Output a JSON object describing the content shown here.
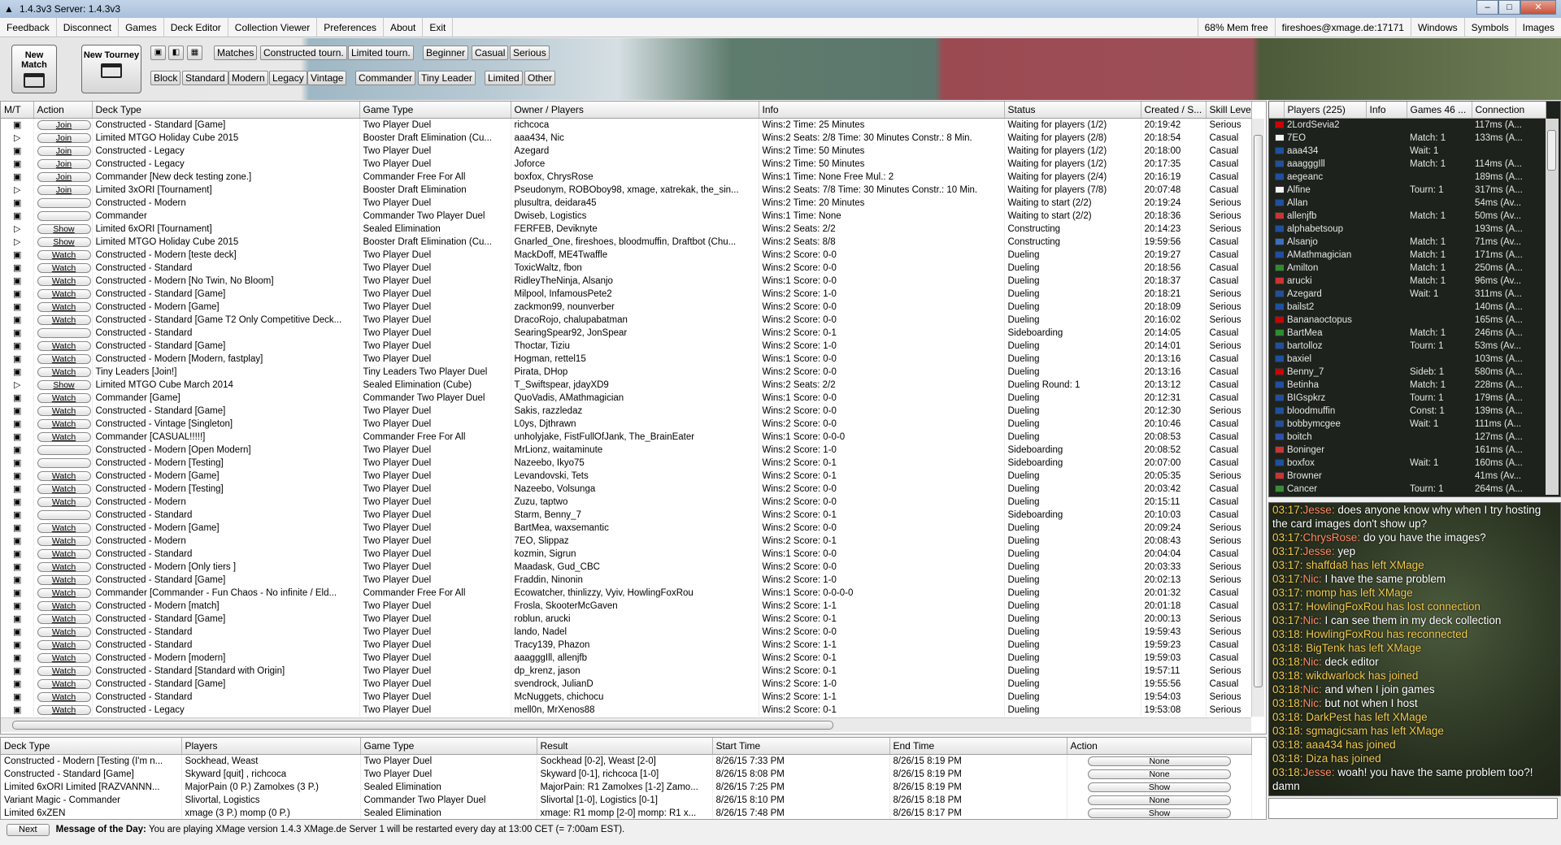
{
  "window": {
    "title": "1.4.3v3  Server: 1.4.3v3"
  },
  "menu": {
    "left": [
      "Feedback",
      "Disconnect",
      "Games",
      "Deck Editor",
      "Collection Viewer",
      "Preferences",
      "About",
      "Exit"
    ],
    "right": [
      "68% Mem free",
      "fireshoes@xmage.de:17171",
      "Windows",
      "Symbols",
      "Images"
    ]
  },
  "toolbar": {
    "new_match": "New Match",
    "new_tourney": "New Tourney",
    "row1": [
      "Matches",
      "Constructed tourn.",
      "Limited tourn.",
      "Beginner",
      "Casual",
      "Serious"
    ],
    "row2": [
      "Block",
      "Standard",
      "Modern",
      "Legacy",
      "Vintage",
      "Commander",
      "Tiny Leader",
      "Limited",
      "Other"
    ]
  },
  "games": {
    "columns": [
      "M/T",
      "Action",
      "Deck Type",
      "Game Type",
      "Owner / Players",
      "Info",
      "Status",
      "Created / S...",
      "Skill Leve"
    ],
    "rows": [
      [
        "Join",
        "Constructed - Standard [Game]",
        "Two Player Duel",
        "richcoca",
        "Wins:2 Time: 25 Minutes",
        "Waiting for players (1/2)",
        "20:19:42",
        "Serious"
      ],
      [
        "Join",
        "Limited MTGO Holiday Cube 2015",
        "Booster Draft Elimination (Cu...",
        "aaa434, Nic",
        "Wins:2 Seats: 2/8 Time: 30 Minutes Constr.: 8 Min.",
        "Waiting for players (2/8)",
        "20:18:54",
        "Casual"
      ],
      [
        "Join",
        "Constructed - Legacy",
        "Two Player Duel",
        "Azegard",
        "Wins:2 Time: 50 Minutes",
        "Waiting for players (1/2)",
        "20:18:00",
        "Casual"
      ],
      [
        "Join",
        "Constructed - Legacy",
        "Two Player Duel",
        "Joforce",
        "Wins:2 Time: 50 Minutes",
        "Waiting for players (1/2)",
        "20:17:35",
        "Casual"
      ],
      [
        "Join",
        "Commander [New deck testing zone.]",
        "Commander Free For All",
        "boxfox, ChrysRose",
        "Wins:1 Time: None Free Mul.: 2",
        "Waiting for players (2/4)",
        "20:16:19",
        "Casual"
      ],
      [
        "Join",
        "Limited 3xORI  [Tournament]",
        "Booster Draft Elimination",
        "Pseudonym, ROBOboy98, xmage, xatrekak, the_sin...",
        "Wins:2 Seats: 7/8 Time: 30 Minutes Constr.: 10 Min.",
        "Waiting for players (7/8)",
        "20:07:48",
        "Casual"
      ],
      [
        "",
        "Constructed - Modern",
        "Two Player Duel",
        "plusultra, deidara45",
        "Wins:2 Time: 20 Minutes",
        "Waiting to start (2/2)",
        "20:19:24",
        "Serious"
      ],
      [
        "",
        "Commander",
        "Commander Two Player Duel",
        "Dwiseb, Logistics",
        "Wins:1 Time: None",
        "Waiting to start (2/2)",
        "20:18:36",
        "Serious"
      ],
      [
        "Show",
        "Limited 6xORI  [Tournament]",
        "Sealed Elimination",
        "FERFEB, Deviknyte",
        "Wins:2 Seats: 2/2",
        "Constructing",
        "20:14:23",
        "Serious"
      ],
      [
        "Show",
        "Limited MTGO Holiday Cube 2015",
        "Booster Draft Elimination (Cu...",
        "Gnarled_One, fireshoes, bloodmuffin, Draftbot (Chu...",
        "Wins:2 Seats: 8/8",
        "Constructing",
        "19:59:56",
        "Casual"
      ],
      [
        "Watch",
        "Constructed - Modern [teste deck]",
        "Two Player Duel",
        "MackDoff, ME4Twaffle",
        "Wins:2 Score: 0-0",
        "Dueling",
        "20:19:27",
        "Casual"
      ],
      [
        "Watch",
        "Constructed - Standard",
        "Two Player Duel",
        "ToxicWaltz, fbon",
        "Wins:2 Score: 0-0",
        "Dueling",
        "20:18:56",
        "Casual"
      ],
      [
        "Watch",
        "Constructed - Modern [No Twin, No Bloom]",
        "Two Player Duel",
        "RidleyTheNinja, Alsanjo",
        "Wins:1 Score: 0-0",
        "Dueling",
        "20:18:37",
        "Casual"
      ],
      [
        "Watch",
        "Constructed - Standard [Game]",
        "Two Player Duel",
        "Milpool, InfamousPete2",
        "Wins:2 Score: 1-0",
        "Dueling",
        "20:18:21",
        "Serious"
      ],
      [
        "Watch",
        "Constructed - Modern [Game]",
        "Two Player Duel",
        "zackmon99, nounverber",
        "Wins:2 Score: 0-0",
        "Dueling",
        "20:18:09",
        "Serious"
      ],
      [
        "Watch",
        "Constructed - Standard [Game T2 Only Competitive Deck...",
        "Two Player Duel",
        "DracoRojo, chalupabatman",
        "Wins:2 Score: 0-0",
        "Dueling",
        "20:16:02",
        "Serious"
      ],
      [
        "",
        "Constructed - Standard",
        "Two Player Duel",
        "SearingSpear92, JonSpear",
        "Wins:2 Score: 0-1",
        "Sideboarding",
        "20:14:05",
        "Casual"
      ],
      [
        "Watch",
        "Constructed - Standard [Game]",
        "Two Player Duel",
        "Thoctar, Tiziu",
        "Wins:2 Score: 1-0",
        "Dueling",
        "20:14:01",
        "Serious"
      ],
      [
        "Watch",
        "Constructed - Modern [Modern, fastplay]",
        "Two Player Duel",
        "Hogman, rettel15",
        "Wins:1 Score: 0-0",
        "Dueling",
        "20:13:16",
        "Casual"
      ],
      [
        "Watch",
        "Tiny Leaders [Join!]",
        "Tiny Leaders Two Player Duel",
        "Pirata, DHop",
        "Wins:2 Score: 0-0",
        "Dueling",
        "20:13:16",
        "Casual"
      ],
      [
        "Show",
        "Limited MTGO Cube March 2014",
        "Sealed Elimination (Cube)",
        "T_Swiftspear, jdayXD9",
        "Wins:2 Seats: 2/2",
        "Dueling Round: 1",
        "20:13:12",
        "Casual"
      ],
      [
        "Watch",
        "Commander [Game]",
        "Commander Two Player Duel",
        "QuoVadis, AMathmagician",
        "Wins:1 Score: 0-0",
        "Dueling",
        "20:12:31",
        "Casual"
      ],
      [
        "Watch",
        "Constructed - Standard [Game]",
        "Two Player Duel",
        "Sakis, razzledaz",
        "Wins:2 Score: 0-0",
        "Dueling",
        "20:12:30",
        "Serious"
      ],
      [
        "Watch",
        "Constructed - Vintage [Singleton]",
        "Two Player Duel",
        "L0ys, Djthrawn",
        "Wins:2 Score: 0-0",
        "Dueling",
        "20:10:46",
        "Casual"
      ],
      [
        "Watch",
        "Commander [CASUAL!!!!!]",
        "Commander Free For All",
        "unholyjake, FistFullOfJank, The_BrainEater",
        "Wins:1 Score: 0-0-0",
        "Dueling",
        "20:08:53",
        "Casual"
      ],
      [
        "",
        "Constructed - Modern [Open Modern]",
        "Two Player Duel",
        "MrLionz, waitaminute",
        "Wins:2 Score: 1-0",
        "Sideboarding",
        "20:08:52",
        "Casual"
      ],
      [
        "",
        "Constructed - Modern [Testing]",
        "Two Player Duel",
        "Nazeebo, Ikyo75",
        "Wins:2 Score: 0-1",
        "Sideboarding",
        "20:07:00",
        "Casual"
      ],
      [
        "Watch",
        "Constructed - Modern [Game]",
        "Two Player Duel",
        "Levandovski, Tets",
        "Wins:2 Score: 0-1",
        "Dueling",
        "20:05:35",
        "Serious"
      ],
      [
        "Watch",
        "Constructed - Modern [Testing]",
        "Two Player Duel",
        "Nazeebo, Volsunga",
        "Wins:2 Score: 0-0",
        "Dueling",
        "20:03:42",
        "Casual"
      ],
      [
        "Watch",
        "Constructed - Modern",
        "Two Player Duel",
        "Zuzu, taptwo",
        "Wins:2 Score: 0-0",
        "Dueling",
        "20:15:11",
        "Casual"
      ],
      [
        "",
        "Constructed - Standard",
        "Two Player Duel",
        "Starm, Benny_7",
        "Wins:2 Score: 0-1",
        "Sideboarding",
        "20:10:03",
        "Casual"
      ],
      [
        "Watch",
        "Constructed - Modern [Game]",
        "Two Player Duel",
        "BartMea, waxsemantic",
        "Wins:2 Score: 0-0",
        "Dueling",
        "20:09:24",
        "Serious"
      ],
      [
        "Watch",
        "Constructed - Modern",
        "Two Player Duel",
        "7EO, Slippaz",
        "Wins:2 Score: 0-1",
        "Dueling",
        "20:08:43",
        "Serious"
      ],
      [
        "Watch",
        "Constructed - Standard",
        "Two Player Duel",
        "kozmin, Sigrun",
        "Wins:1 Score: 0-0",
        "Dueling",
        "20:04:04",
        "Casual"
      ],
      [
        "Watch",
        "Constructed - Modern [Only tiers ]",
        "Two Player Duel",
        "Maadask, Gud_CBC",
        "Wins:2 Score: 0-0",
        "Dueling",
        "20:03:33",
        "Serious"
      ],
      [
        "Watch",
        "Constructed - Standard [Game]",
        "Two Player Duel",
        "Fraddin, Ninonin",
        "Wins:2 Score: 1-0",
        "Dueling",
        "20:02:13",
        "Serious"
      ],
      [
        "Watch",
        "Commander [Commander - Fun Chaos - No infinite / Eld...",
        "Commander Free For All",
        "Ecowatcher, thinlizzy, Vyiv, HowlingFoxRou",
        "Wins:1 Score: 0-0-0-0",
        "Dueling",
        "20:01:32",
        "Casual"
      ],
      [
        "Watch",
        "Constructed - Modern [match]",
        "Two Player Duel",
        "Frosla, SkooterMcGaven",
        "Wins:2 Score: 1-1",
        "Dueling",
        "20:01:18",
        "Casual"
      ],
      [
        "Watch",
        "Constructed - Standard [Game]",
        "Two Player Duel",
        "roblun, arucki",
        "Wins:2 Score: 0-1",
        "Dueling",
        "20:00:13",
        "Serious"
      ],
      [
        "Watch",
        "Constructed - Standard",
        "Two Player Duel",
        "lando, Nadel",
        "Wins:2 Score: 0-0",
        "Dueling",
        "19:59:43",
        "Serious"
      ],
      [
        "Watch",
        "Constructed - Standard",
        "Two Player Duel",
        "Tracy139, Phazon",
        "Wins:2 Score: 1-1",
        "Dueling",
        "19:59:23",
        "Casual"
      ],
      [
        "Watch",
        "Constructed - Modern [modern]",
        "Two Player Duel",
        "aaagggIll, allenjfb",
        "Wins:2 Score: 0-1",
        "Dueling",
        "19:59:03",
        "Casual"
      ],
      [
        "Watch",
        "Constructed - Standard [Standard with Origin]",
        "Two Player Duel",
        "dp_krenz, jason",
        "Wins:2 Score: 0-1",
        "Dueling",
        "19:57:11",
        "Serious"
      ],
      [
        "Watch",
        "Constructed - Standard [Game]",
        "Two Player Duel",
        "svendrock, JulianD",
        "Wins:2 Score: 1-0",
        "Dueling",
        "19:55:56",
        "Casual"
      ],
      [
        "Watch",
        "Constructed - Standard",
        "Two Player Duel",
        "McNuggets, chichocu",
        "Wins:2 Score: 1-1",
        "Dueling",
        "19:54:03",
        "Serious"
      ],
      [
        "Watch",
        "Constructed - Legacy",
        "Two Player Duel",
        "mell0n, MrXenos88",
        "Wins:2 Score: 0-1",
        "Dueling",
        "19:53:08",
        "Serious"
      ]
    ]
  },
  "finished": {
    "columns": [
      "Deck Type",
      "Players",
      "Game Type",
      "Result",
      "Start Time",
      "End Time",
      "Action"
    ],
    "rows": [
      [
        "Constructed - Modern [Testing (I'm n...",
        "Sockhead, Weast",
        "Two Player Duel",
        "Sockhead [0-2], Weast [2-0]",
        "8/26/15 7:33 PM",
        "8/26/15 8:19 PM",
        "None"
      ],
      [
        "Constructed - Standard [Game]",
        "Skyward [quit] , richcoca",
        "Two Player Duel",
        "Skyward [0-1], richcoca [1-0]",
        "8/26/15 8:08 PM",
        "8/26/15 8:19 PM",
        "None"
      ],
      [
        "Limited 6xORI Limited [RAZVANNN...",
        "MajorPain (0 P.) Zamolxes (3 P.)",
        "Sealed Elimination",
        "MajorPain: R1 Zamolxes [1-2]  Zamo...",
        "8/26/15 7:25 PM",
        "8/26/15 8:19 PM",
        "Show"
      ],
      [
        "Variant Magic - Commander",
        "Slivortal, Logistics",
        "Commander Two Player Duel",
        "Slivortal [1-0], Logistics [0-1]",
        "8/26/15 8:10 PM",
        "8/26/15 8:18 PM",
        "None"
      ],
      [
        "Limited 6xZEN",
        "xmage (3 P.) momp (0 P.)",
        "Sealed Elimination",
        "xmage: R1 momp [2-0]  momp: R1 x...",
        "8/26/15 7:48 PM",
        "8/26/15 8:17 PM",
        "Show"
      ]
    ]
  },
  "motd": {
    "next": "Next",
    "label": "Message of the Day:",
    "text": "You are playing XMage version 1.4.3 XMage.de Server 1 will be restarted every day at 13:00 CET (= 7:00am EST)."
  },
  "players": {
    "columns": [
      "",
      "Players (225)",
      "Info",
      "Games 46 ...",
      "Connection"
    ],
    "rows": [
      [
        "2LordSevia2",
        "",
        "117ms (A...",
        "#c00"
      ],
      [
        "7EO",
        "Match: 1",
        "133ms (A...",
        "#f4f4f4"
      ],
      [
        "aaa434",
        "Wait: 1",
        "",
        "#1f4fa0"
      ],
      [
        "aaagggIll",
        "Match: 1",
        "114ms (A...",
        "#1f4fa0"
      ],
      [
        "aegeanc",
        "",
        "189ms (A...",
        "#1f4fa0"
      ],
      [
        "Alfine",
        "Tourn: 1",
        "317ms (A...",
        "#f4f4f4"
      ],
      [
        "Allan",
        "",
        "54ms (Av...",
        "#1f4fa0"
      ],
      [
        "allenjfb",
        "Match: 1",
        "50ms (Av...",
        "#c33"
      ],
      [
        "alphabetsoup",
        "",
        "193ms (A...",
        "#1f4fa0"
      ],
      [
        "Alsanjo",
        "Match: 1",
        "71ms (Av...",
        "#3a6fc2"
      ],
      [
        "AMathmagician",
        "Match: 1",
        "171ms (A...",
        "#1f4fa0"
      ],
      [
        "Amilton",
        "Match: 1",
        "250ms (A...",
        "#2e8b2e"
      ],
      [
        "arucki",
        "Match: 1",
        "96ms (Av...",
        "#c33"
      ],
      [
        "Azegard",
        "Wait: 1",
        "311ms (A...",
        "#1f4fa0"
      ],
      [
        "bailst2",
        "",
        "140ms (A...",
        "#1f4fa0"
      ],
      [
        "Bananaoctopus",
        "",
        "165ms (A...",
        "#c00"
      ],
      [
        "BartMea",
        "Match: 1",
        "246ms (A...",
        "#2e8b2e"
      ],
      [
        "bartolloz",
        "Tourn: 1",
        "53ms (Av...",
        "#1f4fa0"
      ],
      [
        "baxiel",
        "",
        "103ms (A...",
        "#1f4fa0"
      ],
      [
        "Benny_7",
        "Sideb: 1",
        "580ms (A...",
        "#c00"
      ],
      [
        "Betinha",
        "Match: 1",
        "228ms (A...",
        "#1f4fa0"
      ],
      [
        "BIGspkrz",
        "Tourn: 1",
        "179ms (A...",
        "#1f4fa0"
      ],
      [
        "bloodmuffin",
        "Const: 1",
        "139ms (A...",
        "#1f4fa0"
      ],
      [
        "bobbymcgee",
        "Wait: 1",
        "111ms (A...",
        "#1f4fa0"
      ],
      [
        "boitch",
        "",
        "127ms (A...",
        "#3050b0"
      ],
      [
        "Boninger",
        "",
        "161ms (A...",
        "#c33"
      ],
      [
        "boxfox",
        "Wait: 1",
        "160ms (A...",
        "#1f4fa0"
      ],
      [
        "Browner",
        "",
        "41ms (Av...",
        "#c33"
      ],
      [
        "Cancer",
        "Tourn: 1",
        "264ms (A...",
        "#3a8a3a"
      ]
    ]
  },
  "chat": [
    {
      "time": "03:17:",
      "user": "Jesse:",
      "msg": " does anyone know why when I try hosting the card images don't show up?"
    },
    {
      "time": "03:17:",
      "user": "ChrysRose:",
      "msg": " do you have the images?"
    },
    {
      "time": "03:17:",
      "user": "Jesse:",
      "msg": " yep"
    },
    {
      "time": "03:17:",
      "sys": " shaffda8 has left XMage"
    },
    {
      "time": "03:17:",
      "user": "Nic:",
      "msg": " I have the same problem"
    },
    {
      "time": "03:17:",
      "sys": " momp has left XMage"
    },
    {
      "time": "03:17:",
      "sys": " HowlingFoxRou has lost connection"
    },
    {
      "time": "03:17:",
      "user": "Nic:",
      "msg": " I can see them in my deck collection"
    },
    {
      "time": "03:18:",
      "sys": " HowlingFoxRou has reconnected"
    },
    {
      "time": "03:18:",
      "sys": " BigTenk has left XMage"
    },
    {
      "time": "03:18:",
      "user": "Nic:",
      "msg": " deck editor"
    },
    {
      "time": "03:18:",
      "sys": " wikdwarlock has joined"
    },
    {
      "time": "03:18:",
      "user": "Nic:",
      "msg": " and when I join games"
    },
    {
      "time": "03:18:",
      "user": "Nic:",
      "msg": " but not when I host"
    },
    {
      "time": "03:18:",
      "sys": " DarkPest has left XMage"
    },
    {
      "time": "03:18:",
      "sys": " sgmagicsam has left XMage"
    },
    {
      "time": "03:18:",
      "sys": " aaa434 has joined"
    },
    {
      "time": "03:18:",
      "sys": " Diza has joined"
    },
    {
      "time": "03:18:",
      "user": "Jesse:",
      "msg": " woah! you have the same problem too?! damn"
    }
  ]
}
